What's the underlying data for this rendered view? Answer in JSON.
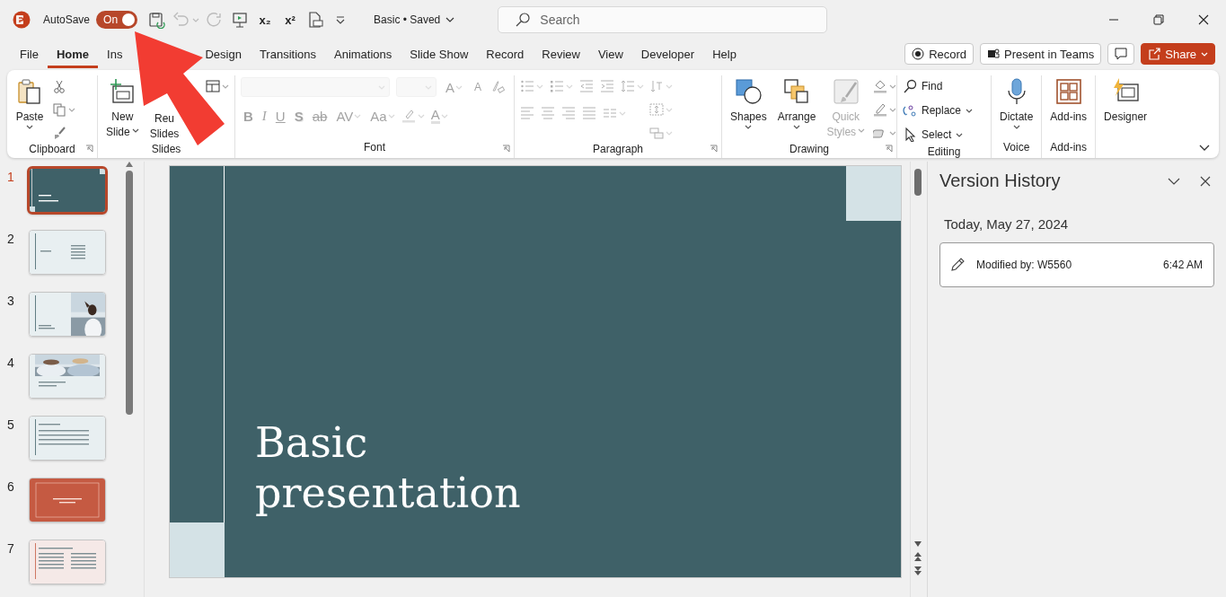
{
  "app": {
    "autosave_label": "AutoSave",
    "autosave": {
      "label": "On",
      "on": true
    },
    "doc_title": "Basic • Saved",
    "search": {
      "placeholder": "Search"
    }
  },
  "quick_access": [
    {
      "kind": "save"
    },
    {
      "kind": "undo",
      "disabled": true
    },
    {
      "kind": "redo",
      "disabled": true
    },
    {
      "kind": "present"
    },
    {
      "kind": "subscript",
      "label": "x₂"
    },
    {
      "kind": "superscript",
      "label": "x²"
    },
    {
      "kind": "print-preview"
    },
    {
      "kind": "customize"
    }
  ],
  "tabs": [
    {
      "label": "File",
      "selected": false
    },
    {
      "label": "Home",
      "selected": true
    },
    {
      "label": "Ins",
      "selected": false
    },
    {
      "label": "Design",
      "selected": false
    },
    {
      "label": "Transitions",
      "selected": false
    },
    {
      "label": "Animations",
      "selected": false
    },
    {
      "label": "Slide Show",
      "selected": false
    },
    {
      "label": "Record",
      "selected": false
    },
    {
      "label": "Review",
      "selected": false
    },
    {
      "label": "View",
      "selected": false
    },
    {
      "label": "Developer",
      "selected": false
    },
    {
      "label": "Help",
      "selected": false
    }
  ],
  "actions": [
    {
      "kind": "record",
      "label": "Record"
    },
    {
      "kind": "teams",
      "label": "Present in Teams"
    },
    {
      "kind": "comment"
    },
    {
      "kind": "share",
      "label": "Share"
    }
  ],
  "ribbon": {
    "groups": [
      {
        "kind": "clipboard",
        "label": "Clipboard",
        "launcher": true,
        "disabled": false,
        "buttons": [
          {
            "kind": "paste",
            "lines": [
              "Paste"
            ],
            "dropdown": true,
            "disabled": false
          }
        ]
      },
      {
        "kind": "slides",
        "label": "Slides",
        "launcher": false,
        "disabled": false,
        "buttons": [
          {
            "kind": "new-slide",
            "lines": [
              "New",
              "Slide"
            ],
            "dropdown": true,
            "disabled": false
          },
          {
            "kind": "reuse-slides",
            "lines": [
              "Reu",
              "Slides"
            ],
            "dropdown": false,
            "disabled": false
          }
        ]
      },
      {
        "kind": "font",
        "label": "Font",
        "launcher": true,
        "disabled": true,
        "buttons": [
          {
            "kind": "grow",
            "label": "A"
          },
          {
            "kind": "shrink",
            "label": "A"
          },
          {
            "kind": "bold",
            "label": "B"
          },
          {
            "kind": "italic",
            "label": "I"
          },
          {
            "kind": "underline",
            "label": "U"
          },
          {
            "kind": "shadow",
            "label": "S"
          },
          {
            "kind": "strikethrough",
            "label": "ab"
          },
          {
            "kind": "spacing",
            "label": "AV"
          },
          {
            "kind": "case",
            "label": "Aa"
          },
          {
            "kind": "font-color",
            "label": "A"
          }
        ]
      },
      {
        "kind": "paragraph",
        "label": "Paragraph",
        "launcher": true,
        "disabled": true
      },
      {
        "kind": "drawing",
        "label": "Drawing",
        "launcher": true,
        "disabled": false,
        "buttons": [
          {
            "kind": "shapes",
            "lines": [
              "Shapes"
            ],
            "dropdown": true,
            "disabled": false
          },
          {
            "kind": "arrange",
            "lines": [
              "Arrange"
            ],
            "dropdown": true,
            "disabled": false
          },
          {
            "kind": "quick-styles",
            "lines": [
              "Quick",
              "Styles"
            ],
            "dropdown": true,
            "disabled": true
          }
        ]
      },
      {
        "kind": "editing",
        "label": "Editing",
        "launcher": false,
        "disabled": false,
        "buttons": [
          {
            "kind": "find",
            "lines": [
              "Find"
            ],
            "dropdown": false,
            "disabled": false
          },
          {
            "kind": "replace",
            "lines": [
              "Replace"
            ],
            "dropdown": true,
            "disabled": false
          },
          {
            "kind": "select",
            "lines": [
              "Select"
            ],
            "dropdown": true,
            "disabled": false
          }
        ]
      },
      {
        "kind": "voice",
        "label": "Voice",
        "launcher": false,
        "disabled": false,
        "buttons": [
          {
            "kind": "dictate",
            "lines": [
              "Dictate"
            ],
            "dropdown": true,
            "disabled": false
          }
        ]
      },
      {
        "kind": "addins",
        "label": "Add-ins",
        "launcher": false,
        "disabled": false,
        "buttons": [
          {
            "kind": "add-ins",
            "lines": [
              "Add-ins"
            ],
            "dropdown": false,
            "disabled": false
          }
        ]
      },
      {
        "kind": "designer",
        "launcher": false,
        "disabled": false,
        "buttons": [
          {
            "kind": "designer",
            "lines": [
              "Designer"
            ],
            "dropdown": false,
            "disabled": false
          }
        ]
      }
    ]
  },
  "slides": [
    {
      "number": "1",
      "kind": "title",
      "selected": true
    },
    {
      "number": "2",
      "kind": "agenda",
      "selected": false
    },
    {
      "number": "3",
      "kind": "photo-side",
      "selected": false
    },
    {
      "number": "4",
      "kind": "photo-top",
      "selected": false
    },
    {
      "number": "5",
      "kind": "text",
      "selected": false
    },
    {
      "number": "6",
      "kind": "accent",
      "selected": false
    },
    {
      "number": "7",
      "kind": "two-column",
      "selected": false
    }
  ],
  "slide": {
    "title": "Basic presentation"
  },
  "version_history": {
    "title": "Version History",
    "date": "Today, May 27, 2024",
    "entries": [
      {
        "label": "Modified by: W5560",
        "time": "6:42 AM"
      }
    ]
  }
}
